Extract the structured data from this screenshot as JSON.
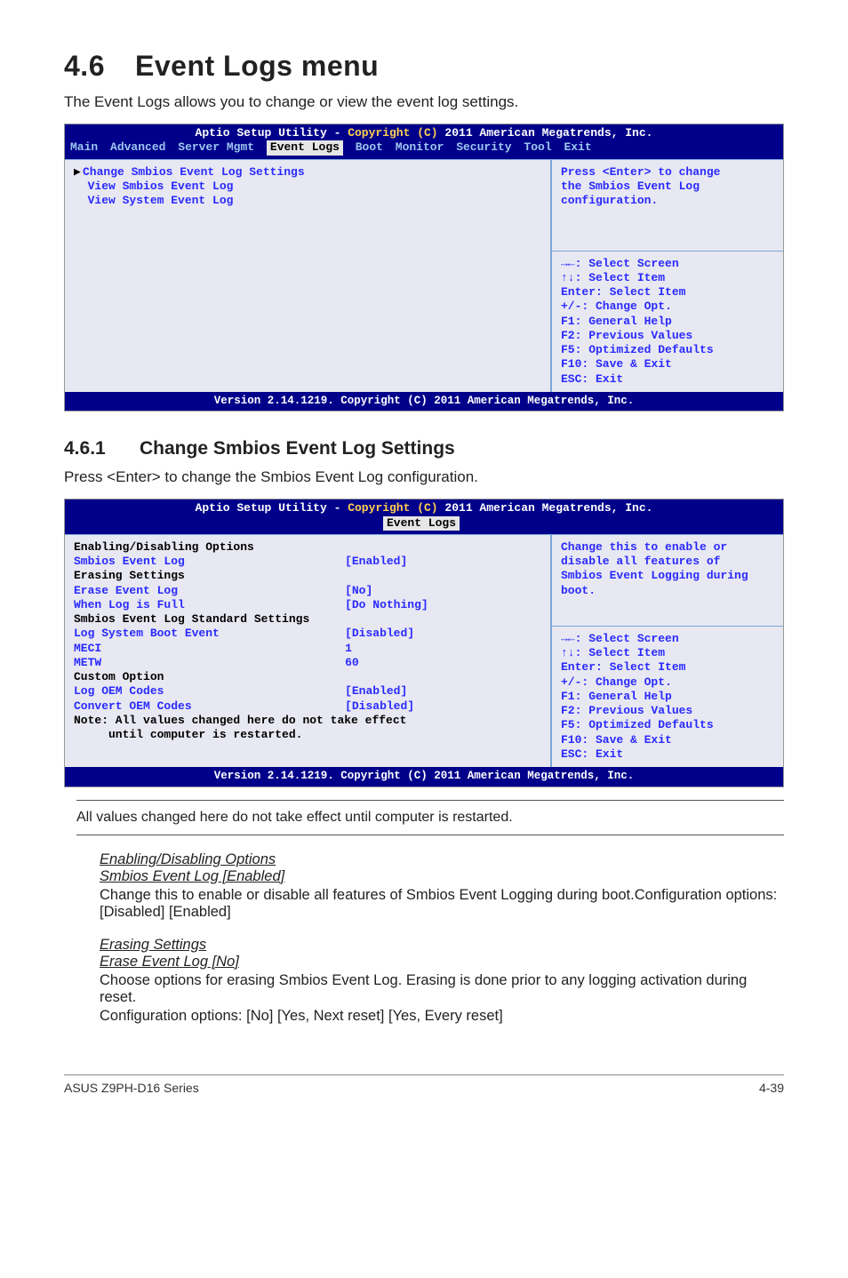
{
  "section": {
    "number": "4.6",
    "title": "Event Logs menu"
  },
  "intro": "The Event Logs allows you to change or view the event log settings.",
  "bios1": {
    "title_pre": "Aptio Setup Utility - ",
    "title_hl": "Copyright (C)",
    "title_post": " 2011 American Megatrends, Inc.",
    "tabs": [
      "Main",
      "Advanced",
      "Server Mgmt",
      "Event Logs",
      "Boot",
      "Monitor",
      "Security",
      "Tool",
      "Exit"
    ],
    "active_tab": 3,
    "left": {
      "items": [
        {
          "pointer": "▶",
          "label": "Change Smbios Event Log Settings"
        },
        {
          "label": ""
        },
        {
          "label": "  View Smbios Event Log"
        },
        {
          "label": "  View System Event Log"
        }
      ]
    },
    "help": [
      "Press <Enter> to change",
      "the Smbios Event Log",
      "configuration."
    ],
    "nav": [
      "→←: Select Screen",
      "↑↓:  Select Item",
      "Enter: Select Item",
      "+/-: Change Opt.",
      "F1: General Help",
      "F2: Previous Values",
      "F5: Optimized Defaults",
      "F10: Save & Exit",
      "ESC: Exit"
    ],
    "footer": "Version 2.14.1219. Copyright (C) 2011 American Megatrends, Inc."
  },
  "subsection": {
    "number": "4.6.1",
    "title": "Change Smbios Event Log Settings"
  },
  "sub_intro": "Press <Enter> to change the Smbios Event Log configuration.",
  "bios2": {
    "title_pre": "Aptio Setup Utility - ",
    "title_hl": "Copyright (C)",
    "title_post": " 2011 American Megatrends, Inc.",
    "active_tab_label": "Event Logs",
    "rows": [
      {
        "type": "heading",
        "label": "Enabling/Disabling Options"
      },
      {
        "label": "Smbios Event Log",
        "value": "[Enabled]"
      },
      {
        "label": ""
      },
      {
        "type": "heading",
        "label": "Erasing Settings"
      },
      {
        "label": "Erase Event Log",
        "value": "[No]"
      },
      {
        "label": "When Log is Full",
        "value": "[Do Nothing]"
      },
      {
        "label": ""
      },
      {
        "type": "heading",
        "label": "Smbios Event Log Standard Settings"
      },
      {
        "label": "Log System Boot Event",
        "value": "[Disabled]"
      },
      {
        "label": "MECI",
        "value": "1"
      },
      {
        "label": "METW",
        "value": "60"
      },
      {
        "label": ""
      },
      {
        "type": "heading",
        "label": "Custom Option"
      },
      {
        "label": "Log OEM Codes",
        "value": "[Enabled]"
      },
      {
        "label": "Convert OEM Codes",
        "value": "[Disabled]"
      },
      {
        "type": "heading",
        "label": "Note: All values changed here do not take effect"
      },
      {
        "type": "heading",
        "label": "     until computer is restarted."
      }
    ],
    "help": [
      "Change this to enable or",
      "disable all features of",
      "Smbios Event Logging during",
      "boot."
    ],
    "nav": [
      "→←: Select Screen",
      "↑↓:  Select Item",
      "Enter: Select Item",
      "+/-: Change Opt.",
      "F1: General Help",
      "F2: Previous Values",
      "F5: Optimized Defaults",
      "F10: Save & Exit",
      "ESC: Exit"
    ],
    "footer": "Version 2.14.1219. Copyright (C) 2011 American Megatrends, Inc."
  },
  "note": "All values changed here do not take effect until computer is restarted.",
  "opt1": {
    "h1": "Enabling/Disabling Options",
    "h2": "Smbios Event Log [Enabled]",
    "p1": "Change this to enable or disable all features of Smbios Event Logging during boot.Configuration options: [Disabled] [Enabled]"
  },
  "opt2": {
    "h1": "Erasing Settings",
    "h2": "Erase Event Log [No]",
    "p1": "Choose options for erasing Smbios Event Log. Erasing is done prior to any logging activation during reset.",
    "p2": "Configuration options: [No] [Yes, Next reset] [Yes, Every reset]"
  },
  "footer": {
    "left": "ASUS Z9PH-D16 Series",
    "right": "4-39"
  }
}
